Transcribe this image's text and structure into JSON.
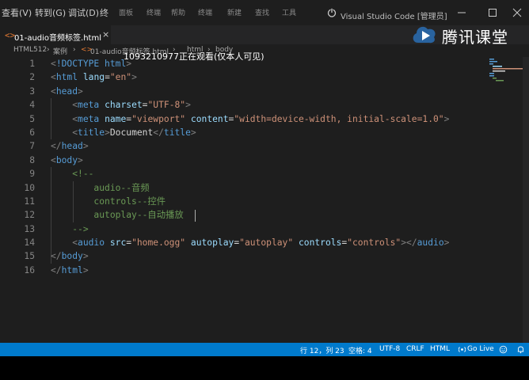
{
  "titlebar": {
    "menu": [
      "查看(V)",
      "转到(G)",
      "调试(D)",
      "终"
    ],
    "menu_blur": [
      "面板",
      "终端",
      "帮助",
      "终端",
      "新建",
      "查找",
      "工具"
    ],
    "window_title": "Visual Studio Code [管理员]"
  },
  "tab": {
    "label": "01-audio音频标签.html",
    "icon": "<>",
    "close": "×"
  },
  "breadcrumb": {
    "items": [
      "HTML512",
      "案例",
      "01-audio音频标签.html",
      "html",
      "body"
    ],
    "separator": "›"
  },
  "watermark": "1093210977正在观看(仅本人可见)",
  "logo": {
    "text": "腾讯课堂"
  },
  "editor": {
    "lines": [
      {
        "n": "1",
        "tokens": [
          [
            "punc",
            "<"
          ],
          [
            "tag",
            "!DOCTYPE"
          ],
          [
            "text",
            " "
          ],
          [
            "tag",
            "html"
          ],
          [
            "punc",
            ">"
          ]
        ]
      },
      {
        "n": "2",
        "tokens": [
          [
            "punc",
            "<"
          ],
          [
            "tag",
            "html"
          ],
          [
            "text",
            " "
          ],
          [
            "attr",
            "lang"
          ],
          [
            "text",
            "="
          ],
          [
            "str",
            "\"en\""
          ],
          [
            "punc",
            ">"
          ]
        ]
      },
      {
        "n": "3",
        "tokens": [
          [
            "punc",
            "<"
          ],
          [
            "tag",
            "head"
          ],
          [
            "punc",
            ">"
          ]
        ]
      },
      {
        "n": "4",
        "tokens": [
          [
            "text",
            "    "
          ],
          [
            "punc",
            "<"
          ],
          [
            "tag",
            "meta"
          ],
          [
            "text",
            " "
          ],
          [
            "attr",
            "charset"
          ],
          [
            "text",
            "="
          ],
          [
            "str",
            "\"UTF-8\""
          ],
          [
            "punc",
            ">"
          ]
        ]
      },
      {
        "n": "5",
        "tokens": [
          [
            "text",
            "    "
          ],
          [
            "punc",
            "<"
          ],
          [
            "tag",
            "meta"
          ],
          [
            "text",
            " "
          ],
          [
            "attr",
            "name"
          ],
          [
            "text",
            "="
          ],
          [
            "str",
            "\"viewport\""
          ],
          [
            "text",
            " "
          ],
          [
            "attr",
            "content"
          ],
          [
            "text",
            "="
          ],
          [
            "str",
            "\"width=device-width, initial-scale=1.0\""
          ],
          [
            "punc",
            ">"
          ]
        ]
      },
      {
        "n": "6",
        "tokens": [
          [
            "text",
            "    "
          ],
          [
            "punc",
            "<"
          ],
          [
            "tag",
            "title"
          ],
          [
            "punc",
            ">"
          ],
          [
            "text",
            "Document"
          ],
          [
            "punc",
            "</"
          ],
          [
            "tag",
            "title"
          ],
          [
            "punc",
            ">"
          ]
        ]
      },
      {
        "n": "7",
        "tokens": [
          [
            "punc",
            "</"
          ],
          [
            "tag",
            "head"
          ],
          [
            "punc",
            ">"
          ]
        ]
      },
      {
        "n": "8",
        "tokens": [
          [
            "punc",
            "<"
          ],
          [
            "tag",
            "body"
          ],
          [
            "punc",
            ">"
          ]
        ]
      },
      {
        "n": "9",
        "tokens": [
          [
            "text",
            "    "
          ],
          [
            "com",
            "<!--"
          ]
        ]
      },
      {
        "n": "10",
        "tokens": [
          [
            "text",
            "        "
          ],
          [
            "com",
            "audio--音频"
          ]
        ]
      },
      {
        "n": "11",
        "tokens": [
          [
            "text",
            "        "
          ],
          [
            "com",
            "controls--控件"
          ]
        ]
      },
      {
        "n": "12",
        "tokens": [
          [
            "text",
            "        "
          ],
          [
            "com",
            "autoplay--自动播放"
          ]
        ]
      },
      {
        "n": "13",
        "tokens": [
          [
            "text",
            "    "
          ],
          [
            "com",
            "-->"
          ]
        ]
      },
      {
        "n": "14",
        "tokens": [
          [
            "text",
            "    "
          ],
          [
            "punc",
            "<"
          ],
          [
            "tag",
            "audio"
          ],
          [
            "text",
            " "
          ],
          [
            "attr",
            "src"
          ],
          [
            "text",
            "="
          ],
          [
            "str",
            "\"home.ogg\""
          ],
          [
            "text",
            " "
          ],
          [
            "attr",
            "autoplay"
          ],
          [
            "text",
            "="
          ],
          [
            "str",
            "\"autoplay\""
          ],
          [
            "text",
            " "
          ],
          [
            "attr",
            "controls"
          ],
          [
            "text",
            "="
          ],
          [
            "str",
            "\"controls\""
          ],
          [
            "punc",
            "></"
          ],
          [
            "tag",
            "audio"
          ],
          [
            "punc",
            ">"
          ]
        ]
      },
      {
        "n": "15",
        "tokens": [
          [
            "punc",
            "</"
          ],
          [
            "tag",
            "body"
          ],
          [
            "punc",
            ">"
          ]
        ]
      },
      {
        "n": "16",
        "tokens": [
          [
            "punc",
            "</"
          ],
          [
            "tag",
            "html"
          ],
          [
            "punc",
            ">"
          ]
        ]
      }
    ]
  },
  "statusbar": {
    "position": "行 12，列 23",
    "spaces": "空格: 4",
    "encoding": "UTF-8",
    "eol": "CRLF",
    "language": "HTML",
    "golive": "Go Live"
  },
  "colors": {
    "titlebar": "#1e1e1e",
    "editor_bg": "#1e1e1e",
    "statusbar": "#007acc",
    "tag": "#569cd6",
    "attr": "#9cdcfe",
    "string": "#ce9178",
    "comment": "#6a9955"
  }
}
